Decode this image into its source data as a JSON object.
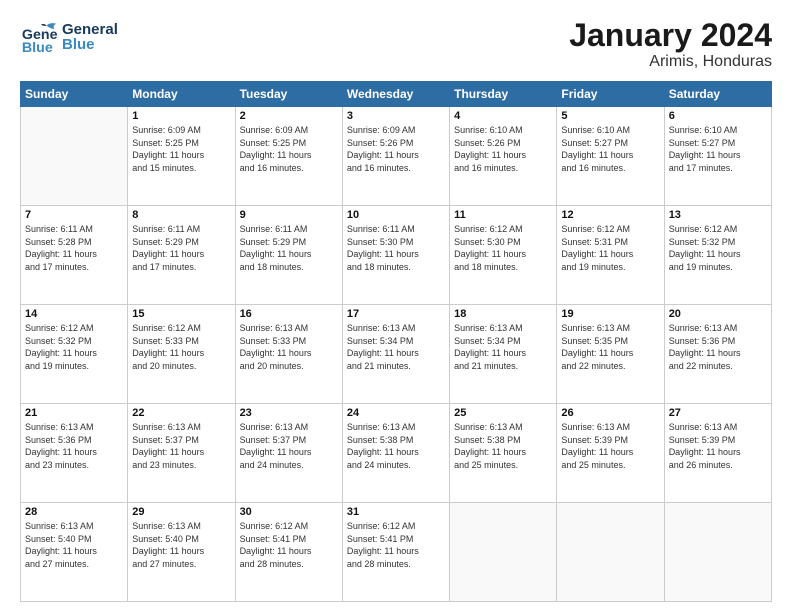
{
  "header": {
    "logo_general": "General",
    "logo_blue": "Blue",
    "title": "January 2024",
    "subtitle": "Arimis, Honduras"
  },
  "days_of_week": [
    "Sunday",
    "Monday",
    "Tuesday",
    "Wednesday",
    "Thursday",
    "Friday",
    "Saturday"
  ],
  "weeks": [
    [
      {
        "num": "",
        "info": ""
      },
      {
        "num": "1",
        "info": "Sunrise: 6:09 AM\nSunset: 5:25 PM\nDaylight: 11 hours\nand 15 minutes."
      },
      {
        "num": "2",
        "info": "Sunrise: 6:09 AM\nSunset: 5:25 PM\nDaylight: 11 hours\nand 16 minutes."
      },
      {
        "num": "3",
        "info": "Sunrise: 6:09 AM\nSunset: 5:26 PM\nDaylight: 11 hours\nand 16 minutes."
      },
      {
        "num": "4",
        "info": "Sunrise: 6:10 AM\nSunset: 5:26 PM\nDaylight: 11 hours\nand 16 minutes."
      },
      {
        "num": "5",
        "info": "Sunrise: 6:10 AM\nSunset: 5:27 PM\nDaylight: 11 hours\nand 16 minutes."
      },
      {
        "num": "6",
        "info": "Sunrise: 6:10 AM\nSunset: 5:27 PM\nDaylight: 11 hours\nand 17 minutes."
      }
    ],
    [
      {
        "num": "7",
        "info": "Sunrise: 6:11 AM\nSunset: 5:28 PM\nDaylight: 11 hours\nand 17 minutes."
      },
      {
        "num": "8",
        "info": "Sunrise: 6:11 AM\nSunset: 5:29 PM\nDaylight: 11 hours\nand 17 minutes."
      },
      {
        "num": "9",
        "info": "Sunrise: 6:11 AM\nSunset: 5:29 PM\nDaylight: 11 hours\nand 18 minutes."
      },
      {
        "num": "10",
        "info": "Sunrise: 6:11 AM\nSunset: 5:30 PM\nDaylight: 11 hours\nand 18 minutes."
      },
      {
        "num": "11",
        "info": "Sunrise: 6:12 AM\nSunset: 5:30 PM\nDaylight: 11 hours\nand 18 minutes."
      },
      {
        "num": "12",
        "info": "Sunrise: 6:12 AM\nSunset: 5:31 PM\nDaylight: 11 hours\nand 19 minutes."
      },
      {
        "num": "13",
        "info": "Sunrise: 6:12 AM\nSunset: 5:32 PM\nDaylight: 11 hours\nand 19 minutes."
      }
    ],
    [
      {
        "num": "14",
        "info": "Sunrise: 6:12 AM\nSunset: 5:32 PM\nDaylight: 11 hours\nand 19 minutes."
      },
      {
        "num": "15",
        "info": "Sunrise: 6:12 AM\nSunset: 5:33 PM\nDaylight: 11 hours\nand 20 minutes."
      },
      {
        "num": "16",
        "info": "Sunrise: 6:13 AM\nSunset: 5:33 PM\nDaylight: 11 hours\nand 20 minutes."
      },
      {
        "num": "17",
        "info": "Sunrise: 6:13 AM\nSunset: 5:34 PM\nDaylight: 11 hours\nand 21 minutes."
      },
      {
        "num": "18",
        "info": "Sunrise: 6:13 AM\nSunset: 5:34 PM\nDaylight: 11 hours\nand 21 minutes."
      },
      {
        "num": "19",
        "info": "Sunrise: 6:13 AM\nSunset: 5:35 PM\nDaylight: 11 hours\nand 22 minutes."
      },
      {
        "num": "20",
        "info": "Sunrise: 6:13 AM\nSunset: 5:36 PM\nDaylight: 11 hours\nand 22 minutes."
      }
    ],
    [
      {
        "num": "21",
        "info": "Sunrise: 6:13 AM\nSunset: 5:36 PM\nDaylight: 11 hours\nand 23 minutes."
      },
      {
        "num": "22",
        "info": "Sunrise: 6:13 AM\nSunset: 5:37 PM\nDaylight: 11 hours\nand 23 minutes."
      },
      {
        "num": "23",
        "info": "Sunrise: 6:13 AM\nSunset: 5:37 PM\nDaylight: 11 hours\nand 24 minutes."
      },
      {
        "num": "24",
        "info": "Sunrise: 6:13 AM\nSunset: 5:38 PM\nDaylight: 11 hours\nand 24 minutes."
      },
      {
        "num": "25",
        "info": "Sunrise: 6:13 AM\nSunset: 5:38 PM\nDaylight: 11 hours\nand 25 minutes."
      },
      {
        "num": "26",
        "info": "Sunrise: 6:13 AM\nSunset: 5:39 PM\nDaylight: 11 hours\nand 25 minutes."
      },
      {
        "num": "27",
        "info": "Sunrise: 6:13 AM\nSunset: 5:39 PM\nDaylight: 11 hours\nand 26 minutes."
      }
    ],
    [
      {
        "num": "28",
        "info": "Sunrise: 6:13 AM\nSunset: 5:40 PM\nDaylight: 11 hours\nand 27 minutes."
      },
      {
        "num": "29",
        "info": "Sunrise: 6:13 AM\nSunset: 5:40 PM\nDaylight: 11 hours\nand 27 minutes."
      },
      {
        "num": "30",
        "info": "Sunrise: 6:12 AM\nSunset: 5:41 PM\nDaylight: 11 hours\nand 28 minutes."
      },
      {
        "num": "31",
        "info": "Sunrise: 6:12 AM\nSunset: 5:41 PM\nDaylight: 11 hours\nand 28 minutes."
      },
      {
        "num": "",
        "info": ""
      },
      {
        "num": "",
        "info": ""
      },
      {
        "num": "",
        "info": ""
      }
    ]
  ]
}
